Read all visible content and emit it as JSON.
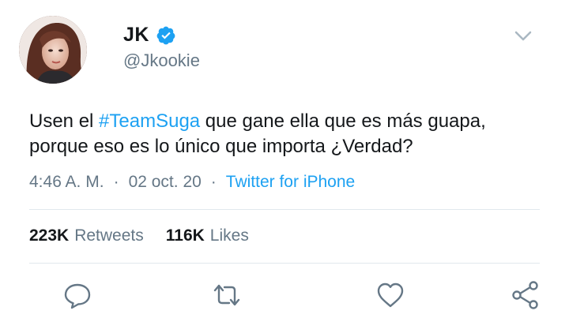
{
  "user": {
    "display_name": "JK",
    "handle": "@Jkookie",
    "verified": true,
    "verified_icon": "verified-badge-icon",
    "verified_color": "#1da1f2"
  },
  "tweet": {
    "text_before": "Usen el ",
    "hashtag": "#TeamSuga",
    "text_after": " que gane ella que es más guapa, porque eso es lo único que importa ¿Verdad?",
    "time": "4:46 A. M.",
    "separator": "·",
    "date": "02 oct. 20",
    "source": "Twitter for iPhone"
  },
  "stats": {
    "retweets_count": "223K",
    "retweets_label": "Retweets",
    "likes_count": "116K",
    "likes_label": "Likes"
  },
  "actions": {
    "reply_icon": "reply-icon",
    "retweet_icon": "retweet-icon",
    "like_icon": "heart-icon",
    "share_icon": "share-icon",
    "menu_icon": "chevron-down-icon"
  },
  "colors": {
    "link": "#1da1f2",
    "secondary_text": "#657786",
    "primary_text": "#14171a",
    "divider": "#e1e8ed"
  }
}
